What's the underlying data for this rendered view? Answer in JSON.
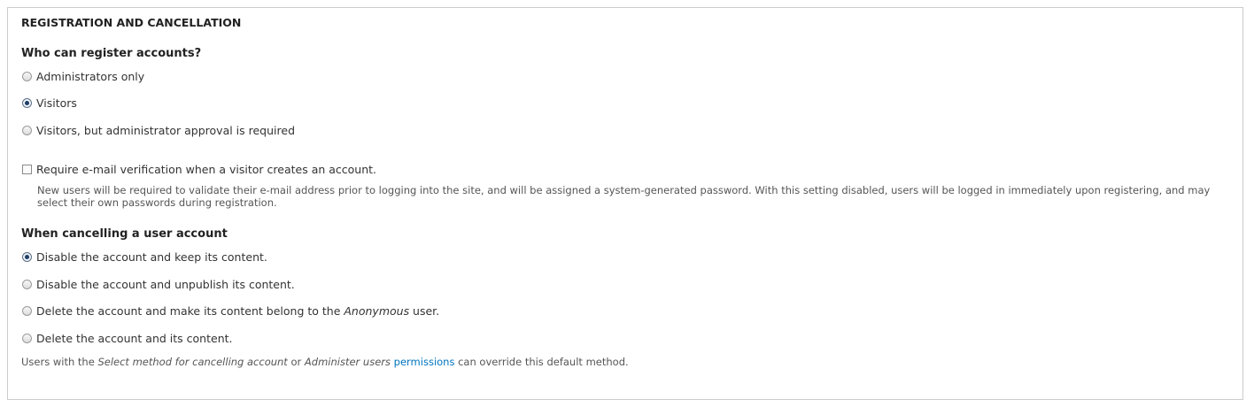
{
  "fieldset": {
    "legend": "REGISTRATION AND CANCELLATION"
  },
  "registration": {
    "label": "Who can register accounts?",
    "options": [
      {
        "label": "Administrators only",
        "checked": false
      },
      {
        "label": "Visitors",
        "checked": true
      },
      {
        "label": "Visitors, but administrator approval is required",
        "checked": false
      }
    ]
  },
  "email_verification": {
    "label": "Require e-mail verification when a visitor creates an account.",
    "checked": false,
    "description": "New users will be required to validate their e-mail address prior to logging into the site, and will be assigned a system-generated password. With this setting disabled, users will be logged in immediately upon registering, and may select their own passwords during registration."
  },
  "cancellation": {
    "label": "When cancelling a user account",
    "options": [
      {
        "label": "Disable the account and keep its content.",
        "checked": true
      },
      {
        "label": "Disable the account and unpublish its content.",
        "checked": false
      },
      {
        "label_before": "Delete the account and make its content belong to the ",
        "label_em": "Anonymous",
        "label_after": " user.",
        "checked": false
      },
      {
        "label": "Delete the account and its content.",
        "checked": false
      }
    ]
  },
  "footer_note": {
    "prefix": "Users with the ",
    "perm1": "Select method for cancelling account",
    "middle": " or ",
    "perm2": "Administer users",
    "space": " ",
    "link": "permissions",
    "suffix": " can override this default method."
  }
}
